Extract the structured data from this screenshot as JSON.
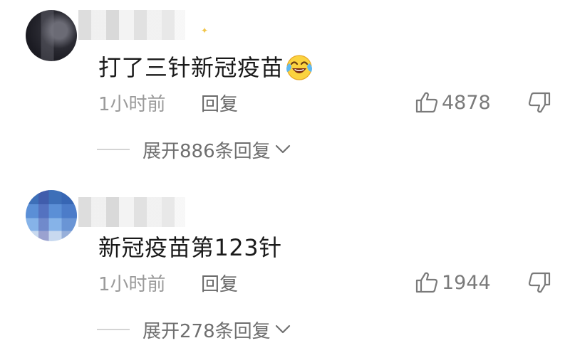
{
  "comments": [
    {
      "text": "打了三针新冠疫苗",
      "emoji": "crying-laughing-emoji",
      "time": "1小时前",
      "reply_label": "回复",
      "likes": "4878",
      "expand_label": "展开886条回复"
    },
    {
      "text": "新冠疫苗第123针",
      "time": "1小时前",
      "reply_label": "回复",
      "likes": "1944",
      "expand_label": "展开278条回复"
    }
  ],
  "icons": {
    "like": "thumbs-up-icon",
    "dislike": "thumbs-down-icon",
    "expand": "chevron-down-icon"
  },
  "colors": {
    "text": "#1a1a1a",
    "meta": "#9a9a9a",
    "secondary": "#6f6f6f"
  }
}
